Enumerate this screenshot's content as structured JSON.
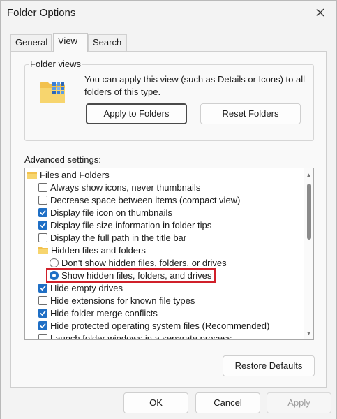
{
  "window": {
    "title": "Folder Options"
  },
  "tabs": [
    {
      "label": "General",
      "active": false
    },
    {
      "label": "View",
      "active": true
    },
    {
      "label": "Search",
      "active": false
    }
  ],
  "folder_views": {
    "heading": "Folder views",
    "description": "You can apply this view (such as Details or Icons) to all folders of this type.",
    "apply_button": "Apply to Folders",
    "reset_button": "Reset Folders"
  },
  "advanced": {
    "label": "Advanced settings:",
    "items": [
      {
        "type": "folder",
        "label": "Files and Folders"
      },
      {
        "type": "checkbox",
        "checked": false,
        "label": "Always show icons, never thumbnails"
      },
      {
        "type": "checkbox",
        "checked": false,
        "label": "Decrease space between items (compact view)"
      },
      {
        "type": "checkbox",
        "checked": true,
        "label": "Display file icon on thumbnails"
      },
      {
        "type": "checkbox",
        "checked": true,
        "label": "Display file size information in folder tips"
      },
      {
        "type": "checkbox",
        "checked": false,
        "label": "Display the full path in the title bar"
      },
      {
        "type": "folder",
        "label": "Hidden files and folders"
      },
      {
        "type": "radio",
        "checked": false,
        "label": "Don't show hidden files, folders, or drives"
      },
      {
        "type": "radio",
        "checked": true,
        "label": "Show hidden files, folders, and drives"
      },
      {
        "type": "checkbox",
        "checked": true,
        "label": "Hide empty drives"
      },
      {
        "type": "checkbox",
        "checked": false,
        "label": "Hide extensions for known file types"
      },
      {
        "type": "checkbox",
        "checked": true,
        "label": "Hide folder merge conflicts"
      },
      {
        "type": "checkbox",
        "checked": true,
        "label": "Hide protected operating system files (Recommended)"
      },
      {
        "type": "checkbox",
        "checked": false,
        "label": "Launch folder windows in a separate process"
      }
    ]
  },
  "restore_button": "Restore Defaults",
  "footer": {
    "ok": "OK",
    "cancel": "Cancel",
    "apply": "Apply"
  },
  "colors": {
    "accent": "#1f6fc5",
    "highlight_border": "#d0202a"
  }
}
